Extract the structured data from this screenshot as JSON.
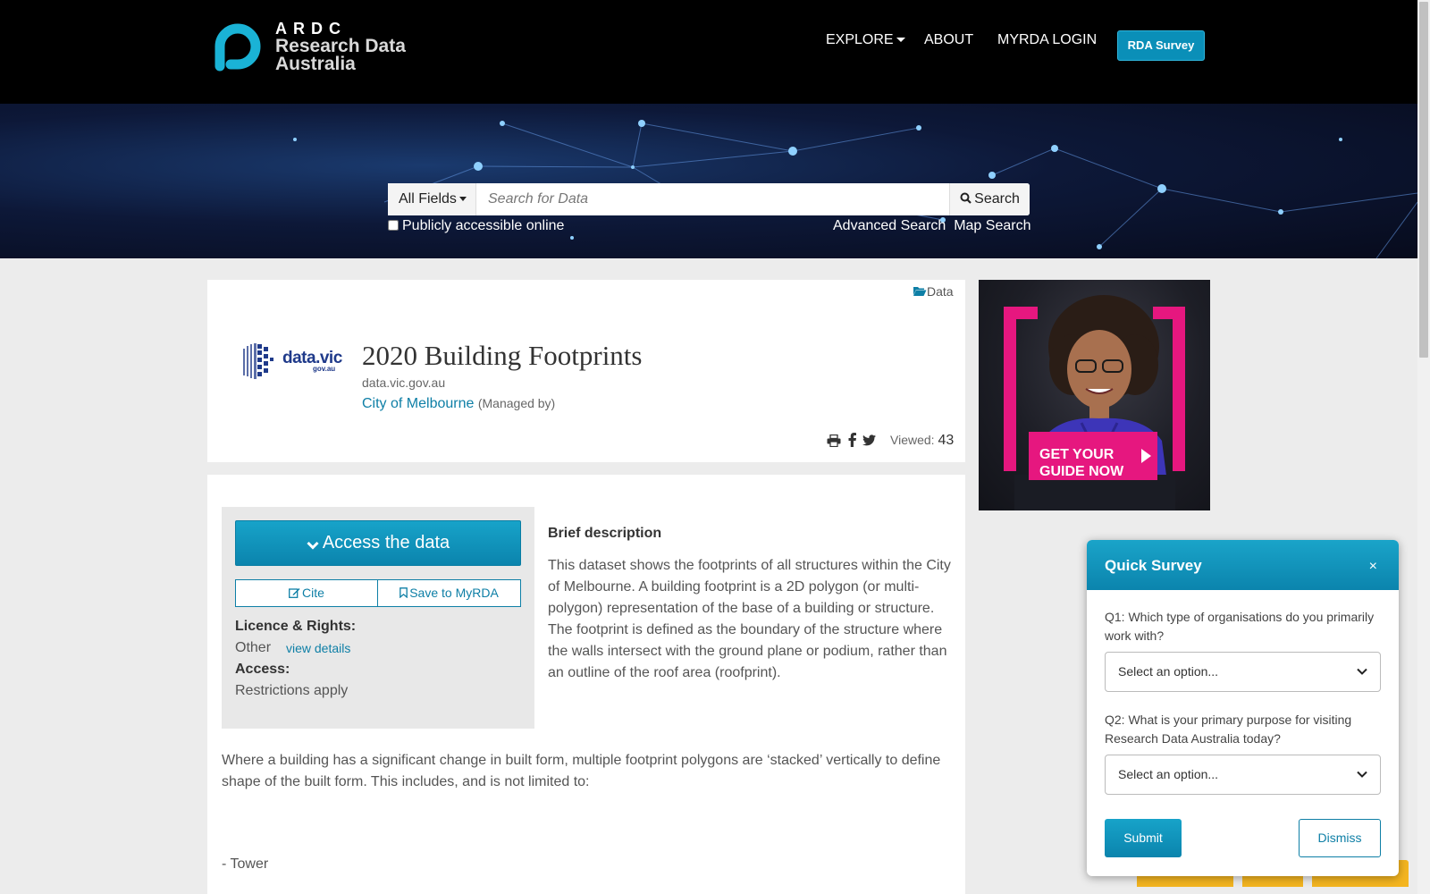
{
  "header": {
    "logo_ardc": "ARDC",
    "logo_line1": "Research Data",
    "logo_line2": "Australia",
    "nav": {
      "explore": "EXPLORE",
      "about": "ABOUT",
      "login": "MYRDA LOGIN"
    },
    "survey_button": "RDA Survey"
  },
  "search": {
    "fields_label": "All Fields",
    "placeholder": "Search for Data",
    "button": "Search",
    "public_label": "Publicly accessible online",
    "advanced": "Advanced Search",
    "map": "Map Search"
  },
  "record": {
    "type_tag": "Data",
    "org_logo_text": "data.vic",
    "org_logo_sub": "gov.au",
    "title": "2020 Building Footprints",
    "source": "data.vic.gov.au",
    "manager": "City of Melbourne",
    "manager_role": "(Managed by)",
    "viewed_label": "Viewed:",
    "viewed_count": "43"
  },
  "access_panel": {
    "access_button": "Access the data",
    "cite": "Cite",
    "save": "Save to MyRDA",
    "licence_label": "Licence & Rights:",
    "licence_value": "Other",
    "view_details": "view details",
    "access_label": "Access:",
    "access_value": "Restrictions apply"
  },
  "description": {
    "heading": "Brief description",
    "text": "This dataset shows the footprints of all structures within the City of Melbourne. A building footprint is a 2D polygon (or multi-polygon) representation of the base of a building or structure. The footprint is defined as the boundary of the structure where the walls intersect with the ground plane or podium, rather than an outline of the roof area (roofprint).",
    "more": "Where a building has a significant change in built form, multiple footprint polygons are ‘stacked’ vertically to define shape of the built form. This includes, and is not limited to:",
    "list_item": "- Tower"
  },
  "ad": {
    "line1": "GET YOUR",
    "line2": "GUIDE NOW",
    "accent": "#e6177f"
  },
  "survey": {
    "title": "Quick Survey",
    "close": "×",
    "q1": "Q1: Which type of organisations do you primarily work with?",
    "q1_select": "Select an option...",
    "q2": "Q2: What is your primary purpose for visiting Research Data Australia today?",
    "q2_select": "Select an option...",
    "submit": "Submit",
    "dismiss": "Dismiss"
  },
  "colors": {
    "brand_teal": "#0e7fa6",
    "button_teal": "#17a3c9",
    "logo_cyan": "#1ab3d6",
    "header_bg": "#000000"
  }
}
